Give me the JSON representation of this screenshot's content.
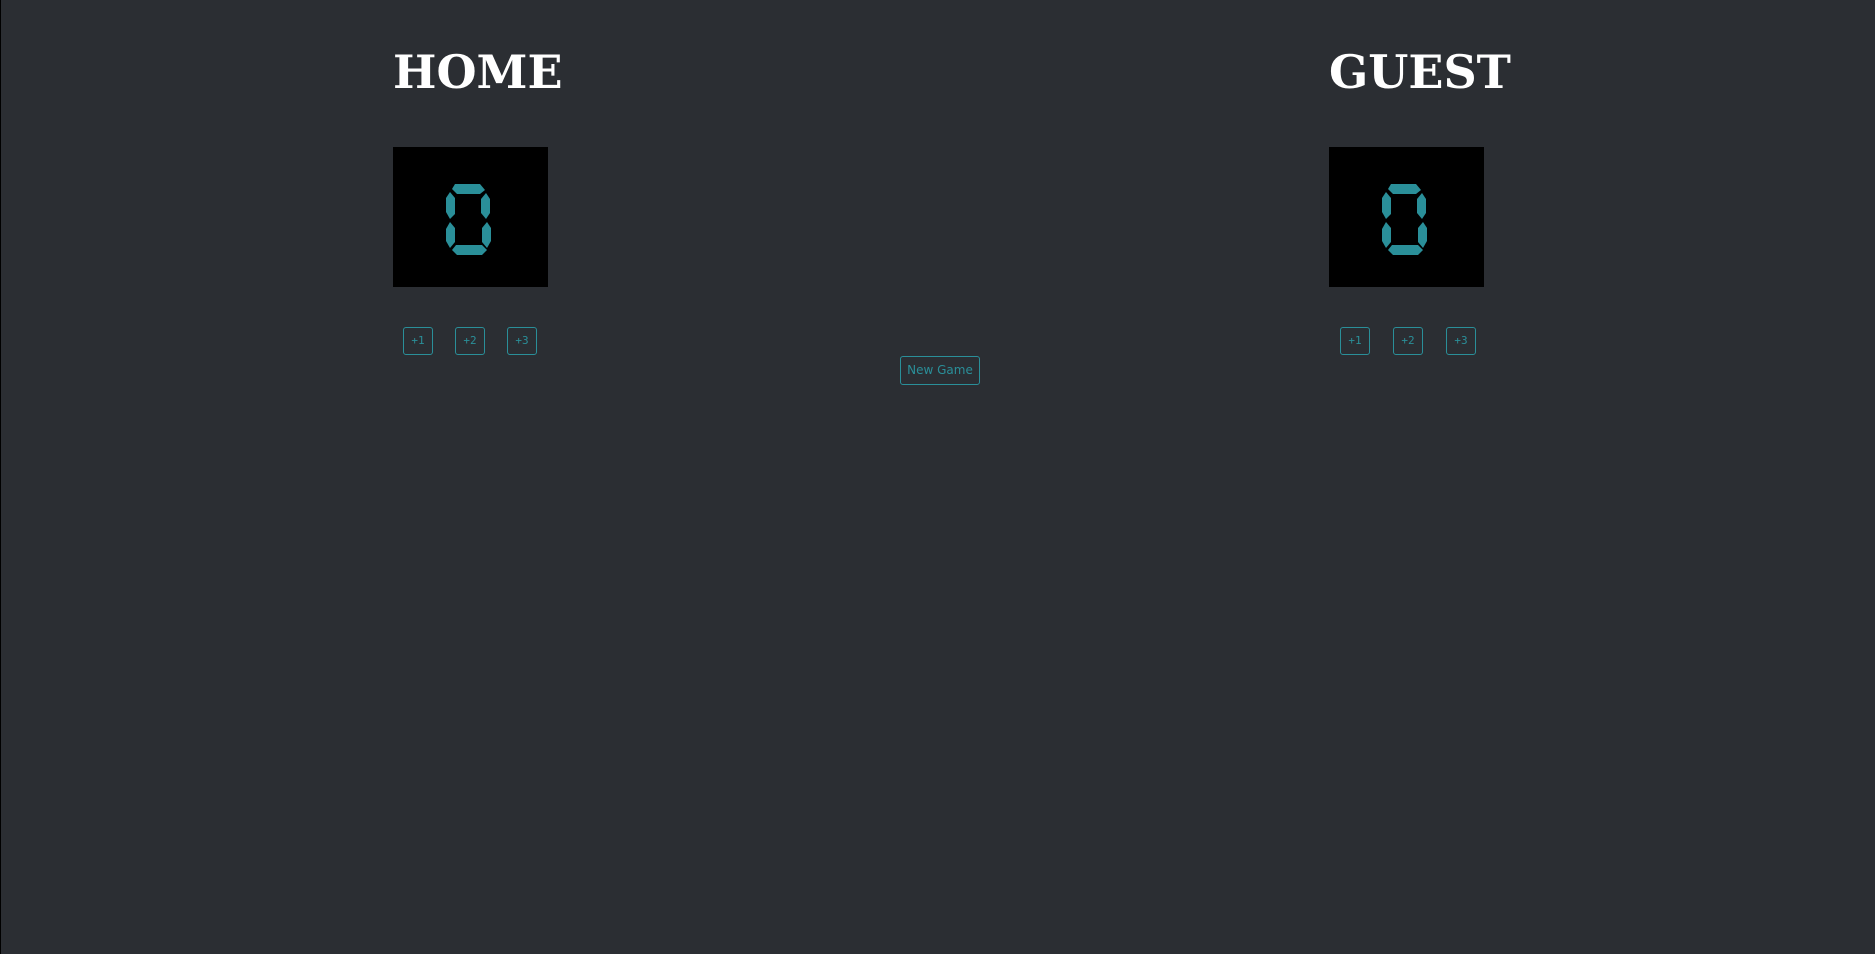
{
  "home": {
    "title": "HOME",
    "score": "0",
    "buttons": [
      "+1",
      "+2",
      "+3"
    ]
  },
  "guest": {
    "title": "GUEST",
    "score": "0",
    "buttons": [
      "+1",
      "+2",
      "+3"
    ]
  },
  "new_game_label": "New Game",
  "colors": {
    "background": "#2b2e33",
    "accent": "#2a8f99",
    "score_bg": "#000000",
    "title": "#ffffff"
  }
}
